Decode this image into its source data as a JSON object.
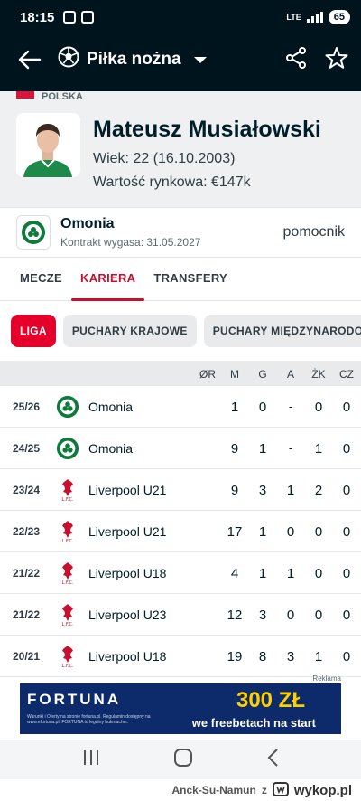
{
  "status_bar": {
    "time": "18:15",
    "network": "LTE",
    "battery": "65"
  },
  "header": {
    "sport": "Piłka nożna"
  },
  "player": {
    "country": "POLSKA",
    "name": "Mateusz Musiałowski",
    "age": "Wiek: 22 (16.10.2003)",
    "market_value": "Wartość rynkowa: €147k"
  },
  "club": {
    "name": "Omonia",
    "contract": "Kontrakt wygasa: 31.05.2027",
    "position": "pomocnik"
  },
  "tabs": [
    "MECZE",
    "KARIERA",
    "TRANSFERY"
  ],
  "chips": [
    "LIGA",
    "PUCHARY KRAJOWE",
    "PUCHARY MIĘDZYNARODOWE"
  ],
  "table": {
    "columns": [
      "ØR",
      "M",
      "G",
      "A",
      "ŻK",
      "CZ"
    ],
    "rows": [
      {
        "season": "25/26",
        "team": "Omonia",
        "logo": "omonia-logo",
        "r": "",
        "m": "1",
        "g": "0",
        "a": "-",
        "zk": "0",
        "cz": "0"
      },
      {
        "season": "24/25",
        "team": "Omonia",
        "logo": "omonia-logo",
        "r": "",
        "m": "9",
        "g": "1",
        "a": "-",
        "zk": "1",
        "cz": "0"
      },
      {
        "season": "23/24",
        "team": "Liverpool U21",
        "logo": "liverpool-logo",
        "r": "",
        "m": "9",
        "g": "3",
        "a": "1",
        "zk": "2",
        "cz": "0"
      },
      {
        "season": "22/23",
        "team": "Liverpool U21",
        "logo": "liverpool-logo",
        "r": "",
        "m": "17",
        "g": "1",
        "a": "0",
        "zk": "0",
        "cz": "0"
      },
      {
        "season": "21/22",
        "team": "Liverpool U18",
        "logo": "liverpool-logo",
        "r": "",
        "m": "4",
        "g": "1",
        "a": "1",
        "zk": "0",
        "cz": "0"
      },
      {
        "season": "21/22",
        "team": "Liverpool U23",
        "logo": "liverpool-logo",
        "r": "",
        "m": "12",
        "g": "3",
        "a": "0",
        "zk": "0",
        "cz": "0"
      },
      {
        "season": "20/21",
        "team": "Liverpool U18",
        "logo": "liverpool-logo",
        "r": "",
        "m": "19",
        "g": "8",
        "a": "3",
        "zk": "1",
        "cz": "0"
      }
    ]
  },
  "ad": {
    "label": "Reklama",
    "brand": "FORTUNA",
    "headline": "300 ZŁ",
    "subline": "we freebetach na start",
    "disclaimer": "Warunki i Oferty na stronie fortuna.pl. Regulamin dostępny na www.efortuna.pl. FORTUNA to legalny bukmacher."
  },
  "watermark": {
    "user": "Anck-Su-Namun",
    "suffix": "z",
    "site": "wykop.pl"
  },
  "colors": {
    "header_bg": "#00141e",
    "accent": "#c8102e",
    "chip_active": "#e4002b"
  }
}
